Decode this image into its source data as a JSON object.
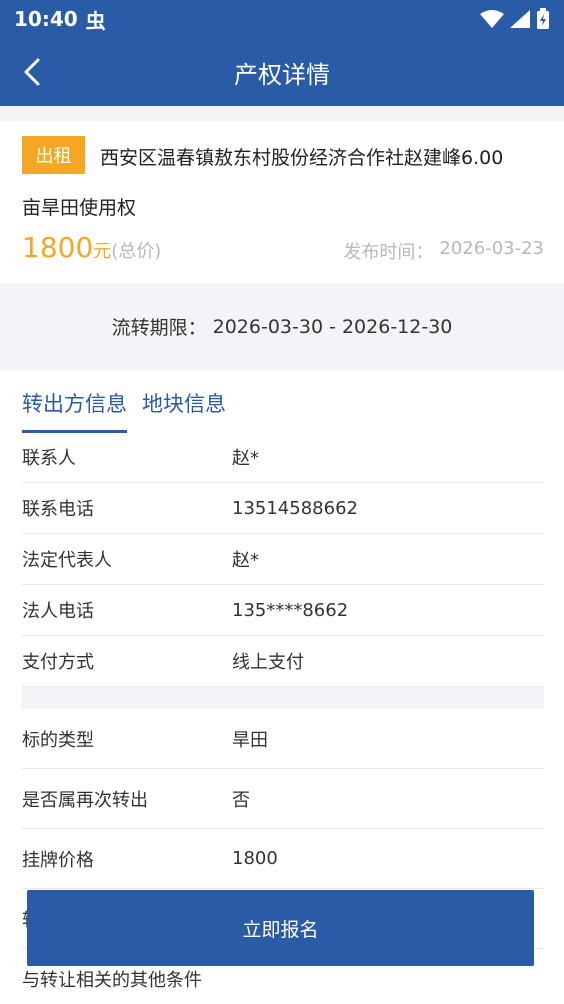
{
  "status_bar": {
    "time": "10:40",
    "bug_glyph": "虫"
  },
  "app_bar": {
    "title": "产权详情",
    "back_icon": "chevron-left-icon"
  },
  "listing": {
    "tag": "出租",
    "title_line1": "西安区温春镇敖东村股份经济合作社赵建峰6.00",
    "title_line2": "亩旱田使用权",
    "price": "1800",
    "price_unit": "元",
    "price_note": "(总价)",
    "publish_label": "发布时间：",
    "publish_date": "2026-03-23"
  },
  "period": {
    "label": "流转期限：",
    "value": "2026-03-30 - 2026-12-30"
  },
  "tabs": [
    {
      "label": "转出方信息",
      "active": true
    },
    {
      "label": "地块信息",
      "active": false
    }
  ],
  "seller_rows": [
    {
      "label": "联系人",
      "value": "赵*"
    },
    {
      "label": "联系电话",
      "value": "13514588662"
    },
    {
      "label": "法定代表人",
      "value": "赵*"
    },
    {
      "label": "法人电话",
      "value": "135****8662"
    },
    {
      "label": "支付方式",
      "value": "线上支付"
    }
  ],
  "plot_rows": [
    {
      "label": "标的类型",
      "value": "旱田"
    },
    {
      "label": "是否属再次转出",
      "value": "否"
    },
    {
      "label": "挂牌价格",
      "value": "1800"
    }
  ],
  "hidden_row_label": "转",
  "last_row_label": "与转让相关的其他条件",
  "cta": {
    "label": "立即报名"
  },
  "colors": {
    "primary": "#2a5ba6",
    "accent": "#f5a623",
    "muted": "#b8b8b8"
  }
}
